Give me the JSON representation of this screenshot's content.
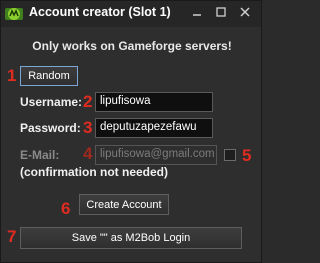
{
  "window": {
    "title": "Account creator (Slot 1)",
    "minimize_label": "minimize",
    "maximize_label": "maximize",
    "close_label": "close"
  },
  "subtitle": "Only works on Gameforge servers!",
  "markers": [
    "1",
    "2",
    "3",
    "4",
    "5",
    "6",
    "7"
  ],
  "random_button": "Random",
  "username": {
    "label": "Username:",
    "value": "lipufisowa"
  },
  "password": {
    "label": "Password:",
    "value": "deputuzapezefawu"
  },
  "email": {
    "label": "E-Mail:",
    "placeholder": "lipufisowa@gmail.com",
    "note": "(confirmation not needed)"
  },
  "create_button": "Create Account",
  "save_button": "Save \"\" as M2Bob Login",
  "colors": {
    "marker": "#e02b20",
    "background": "#2e2e2e",
    "field": "#0f0f0f"
  }
}
